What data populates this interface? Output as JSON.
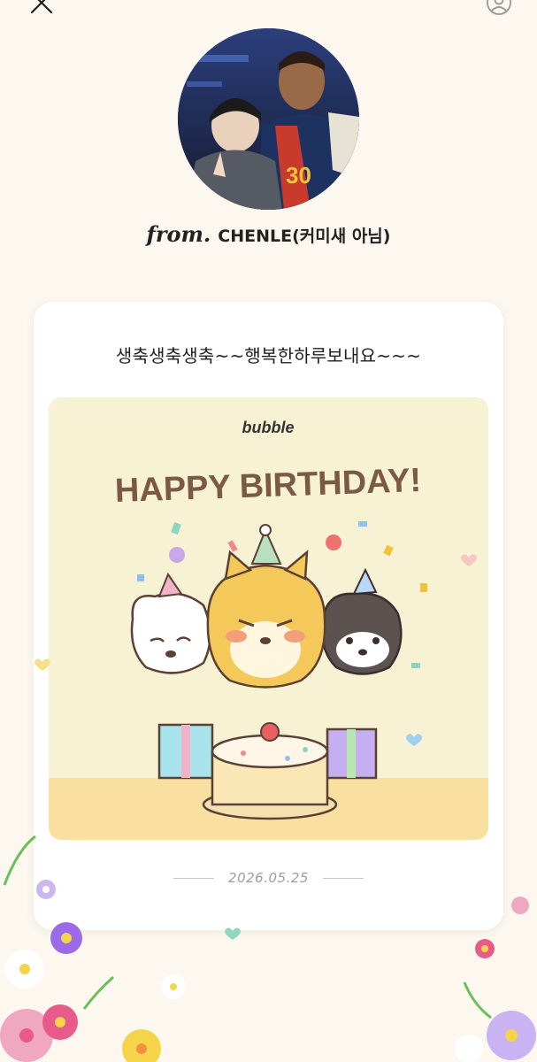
{
  "topbar": {
    "close_icon": "close-icon",
    "profile_icon": "profile-icon"
  },
  "sender": {
    "from_label": "from.",
    "name": "CHENLE(커미새 아님)",
    "avatar": "sender-avatar-photo"
  },
  "letter": {
    "message": "생축생축생축~~행복한하루보내요~~~",
    "image": {
      "brand": "bubble",
      "headline": "HAPPY BIRTHDAY!",
      "description": "three shiba dogs with party hats, gifts and a birthday cake"
    },
    "date": "2026.05.25"
  },
  "colors": {
    "background": "#fcf8ef",
    "card": "#ffffff",
    "image_bg": "#f8f2d4",
    "headline": "#7a5a45"
  }
}
